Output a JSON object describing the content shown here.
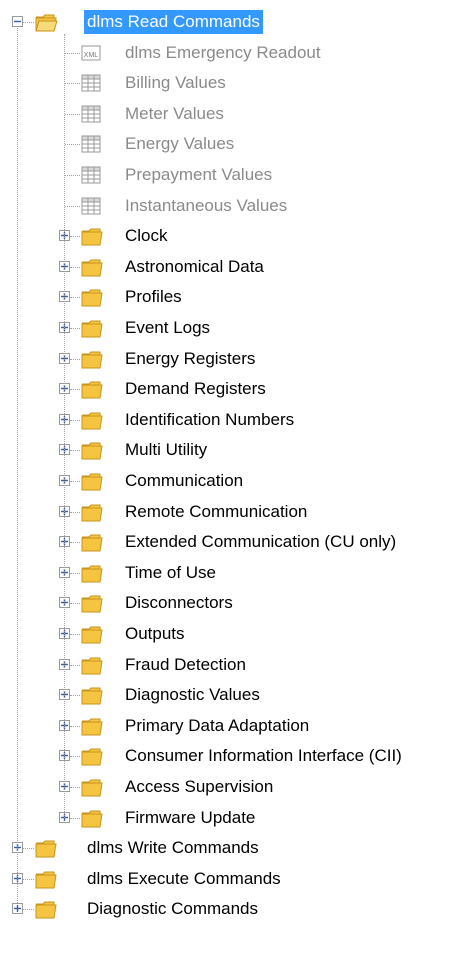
{
  "root": {
    "label": "dlms Read Commands"
  },
  "leaves": [
    {
      "label": "dlms Emergency Readout",
      "icon": "xml-file-icon",
      "icon_text": "XML"
    },
    {
      "label": "Billing Values",
      "icon": "table-icon"
    },
    {
      "label": "Meter Values",
      "icon": "table-icon"
    },
    {
      "label": "Energy Values",
      "icon": "table-icon"
    },
    {
      "label": "Prepayment Values",
      "icon": "table-icon"
    },
    {
      "label": "Instantaneous Values",
      "icon": "table-icon"
    }
  ],
  "folders": [
    "Clock",
    "Astronomical Data",
    "Profiles",
    "Event Logs",
    "Energy Registers",
    "Demand Registers",
    "Identification Numbers",
    "Multi Utility",
    "Communication",
    "Remote Communication",
    "Extended Communication (CU only)",
    "Time of Use",
    "Disconnectors",
    "Outputs",
    "Fraud Detection",
    "Diagnostic Values",
    "Primary Data Adaptation",
    "Consumer Information Interface (CII)",
    "Access Supervision",
    "Firmware Update"
  ],
  "top_folders": [
    "dlms Write Commands",
    "dlms Execute Commands",
    "Diagnostic Commands"
  ],
  "colors": {
    "selection": "#3399ff",
    "folder": "#f5c542",
    "folder_edge": "#c8931a",
    "dim_text": "#8a8a8a"
  }
}
